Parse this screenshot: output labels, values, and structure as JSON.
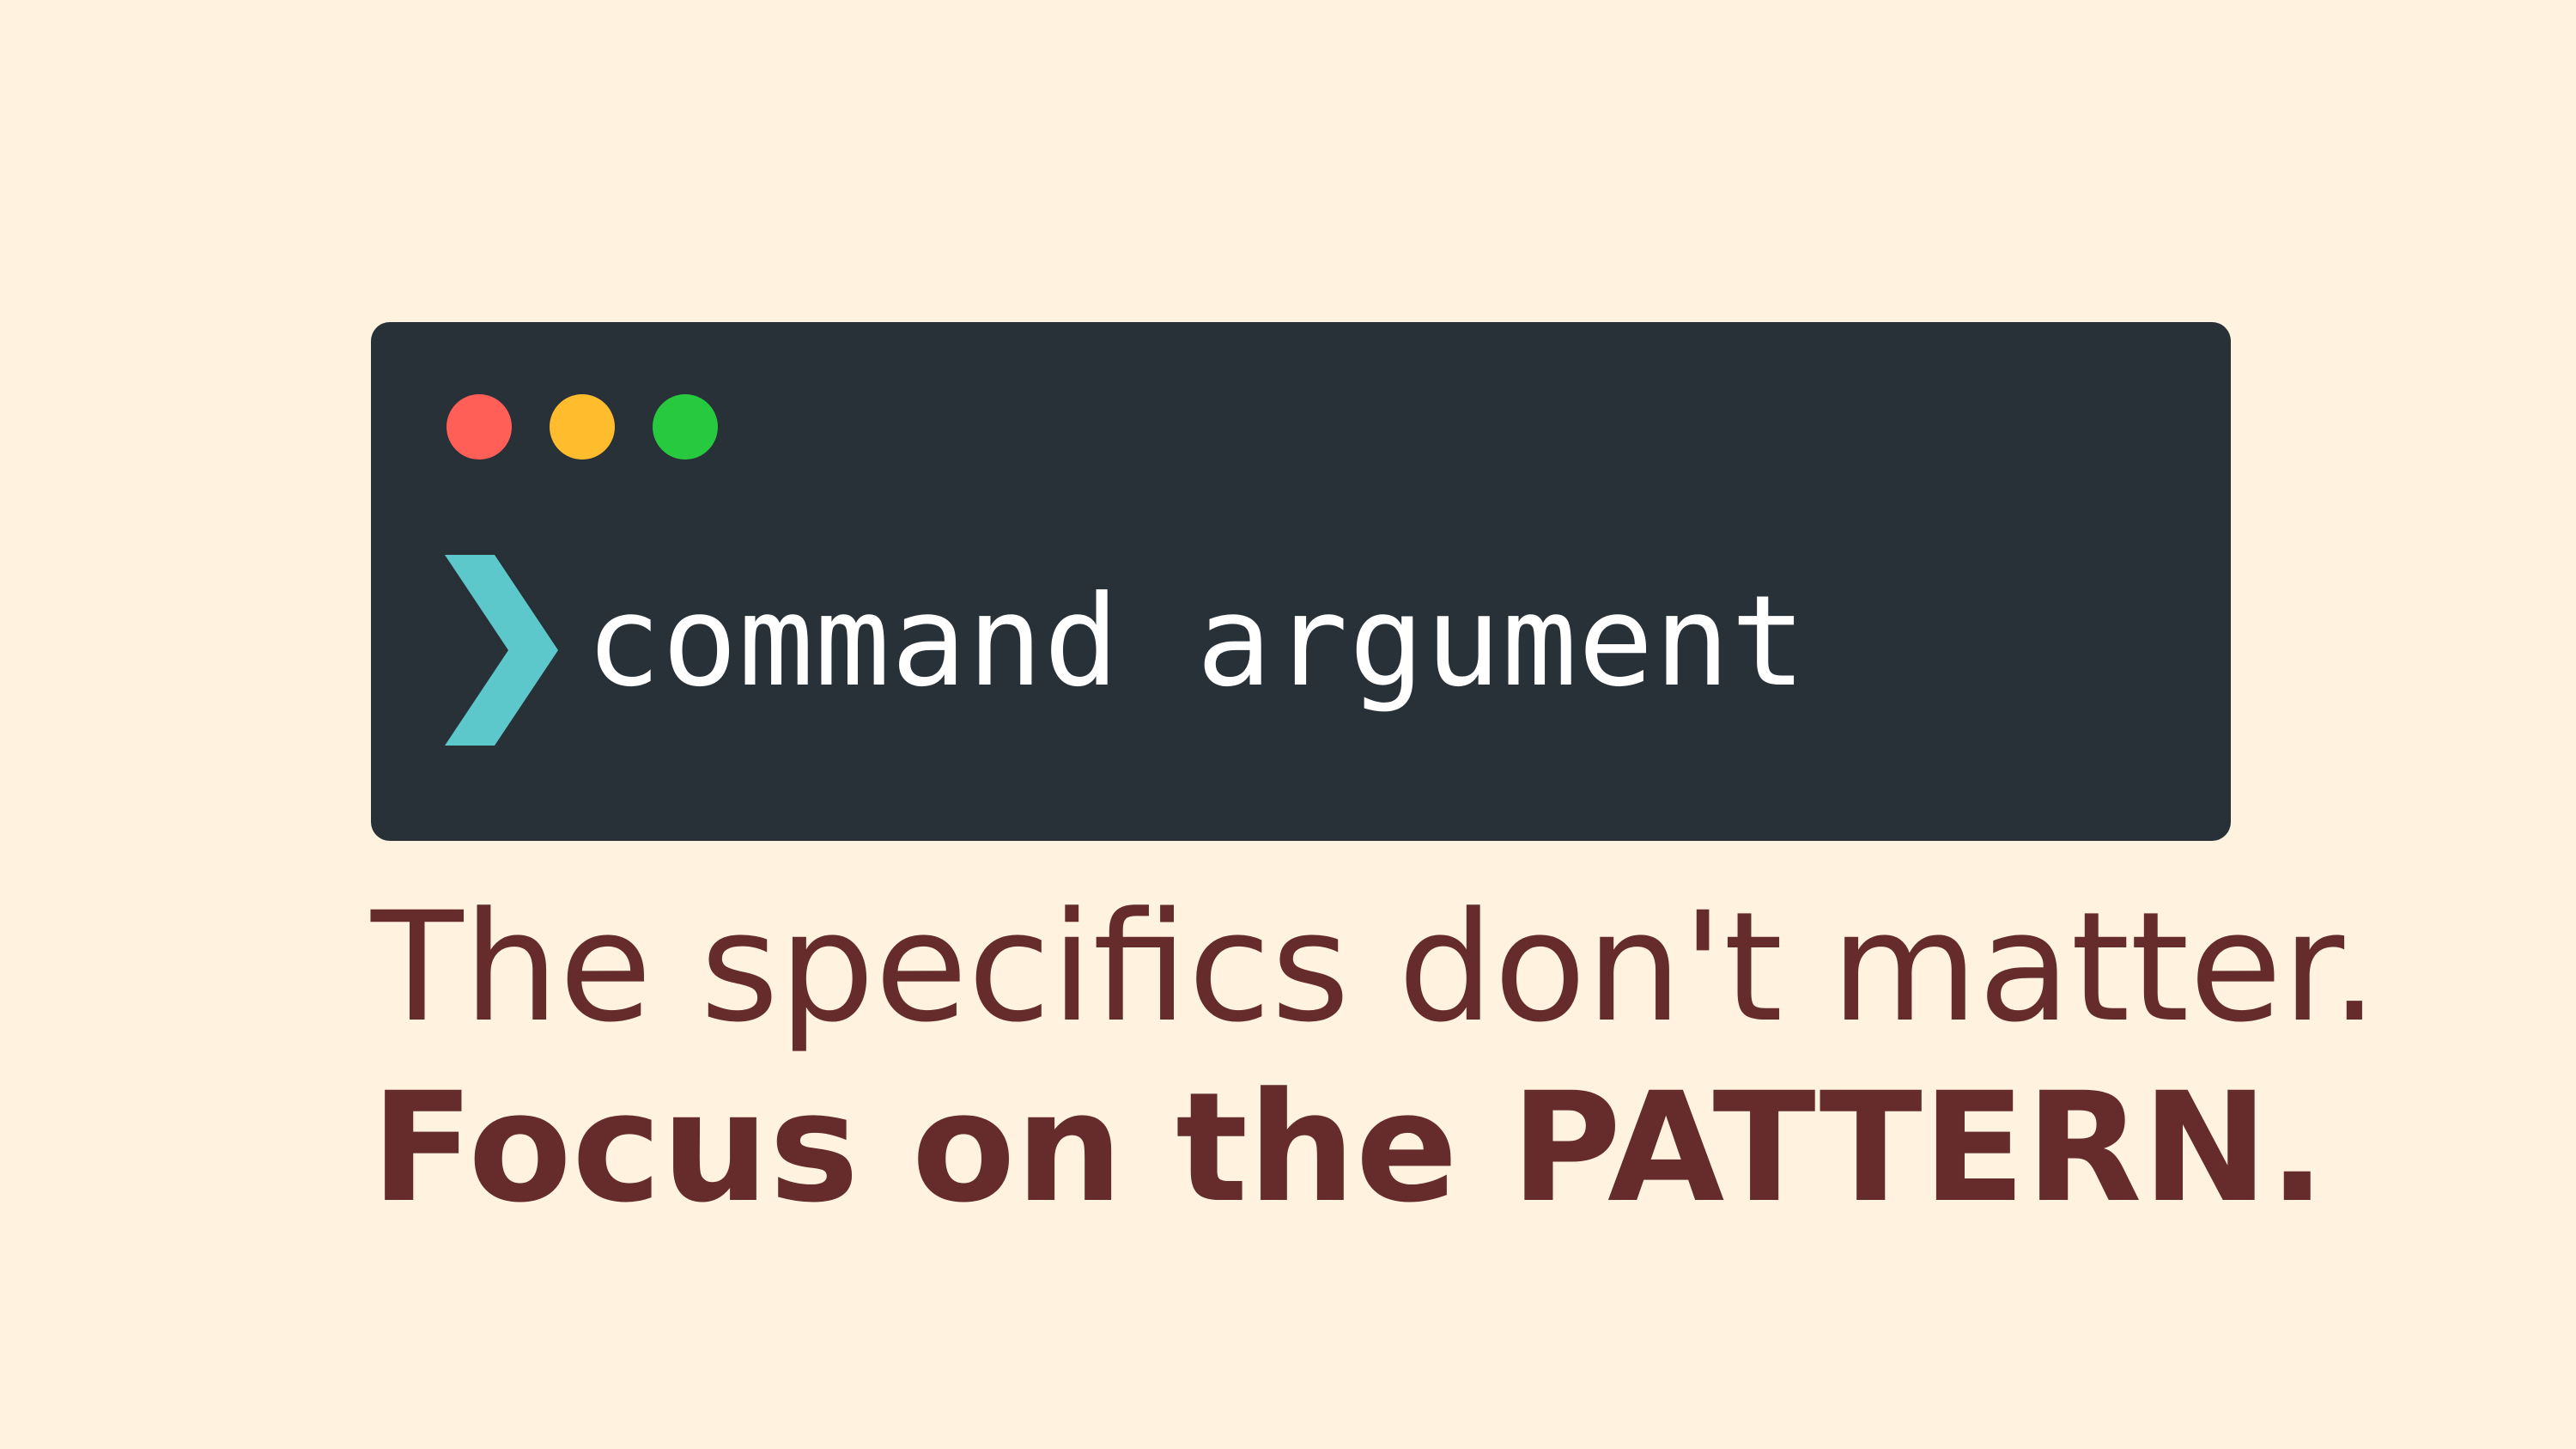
{
  "terminal": {
    "window_controls": {
      "close_color": "#ff5f56",
      "minimize_color": "#ffbd2e",
      "maximize_color": "#27c93f"
    },
    "prompt_icon": "chevron-right-icon",
    "prompt_color": "#5cc8cc",
    "command": "command",
    "argument": "argument"
  },
  "caption": {
    "line1": "The specifics don't matter.",
    "line2": "Focus on the PATTERN."
  },
  "colors": {
    "background": "#fff3e0",
    "terminal_background": "#283038",
    "caption_text": "#662c2c"
  }
}
